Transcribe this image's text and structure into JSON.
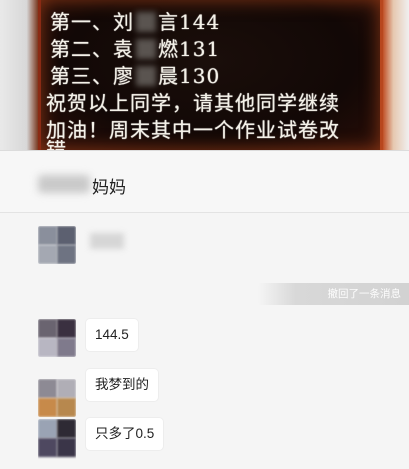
{
  "image": {
    "lines": [
      {
        "prefix": "第一、刘",
        "suffix": "言144"
      },
      {
        "prefix": "第二、袁",
        "suffix": "燃131"
      },
      {
        "prefix": "第三、廖",
        "suffix": "晨130"
      },
      {
        "prefix": "祝贺以上同学，请其他同学继续",
        "suffix": ""
      },
      {
        "prefix": "加油！周末其中一个作业试卷改",
        "suffix": ""
      },
      {
        "prefix": "错",
        "suffix": ""
      }
    ]
  },
  "chat": {
    "title": "妈妈",
    "recall_notice": "撤回了一条消息",
    "messages": [
      {
        "text": "144.5"
      },
      {
        "text": "我梦到的"
      },
      {
        "text": "只多了0.5"
      }
    ]
  },
  "colors": {
    "board_border": "#b8461e",
    "chat_bg": "#f5f5f5",
    "bubble_bg": "#ffffff"
  }
}
